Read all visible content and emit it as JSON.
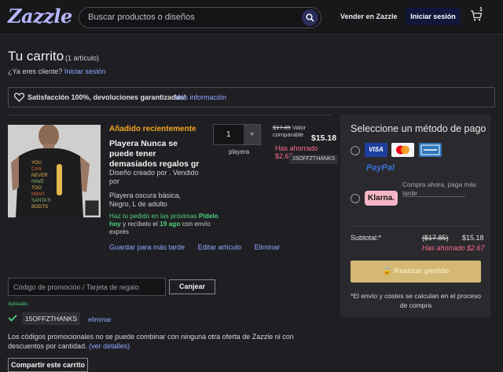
{
  "header": {
    "logo": "Zazzle",
    "search_placeholder": "Buscar productos o diseños",
    "sell_label": "Vender en Zazzle",
    "login_label": "Iniciar sesión",
    "cart_count": "1"
  },
  "page": {
    "title": "Tu carrito",
    "item_count": "(1 artículo)",
    "client_question": "¿Ya eres cliente?",
    "client_login": "Iniciar sesión"
  },
  "banner": {
    "text": "Satisfacción 100%, devoluciones garantizadas!",
    "link": "Más información"
  },
  "item": {
    "recent_label": "Añadido recientemente",
    "name": "Playera Nunca se puede tener demasiados regalos gr",
    "designed_by": "Diseño creado por . Vendido por",
    "variant": "Playera oscura básica, Negro, L de adulto",
    "delivery_prefix": "Haz tu pedido en las próximas",
    "delivery_cta": "Pídelo hoy",
    "delivery_mid": "y recíbelo el",
    "delivery_date": "19 ago",
    "delivery_suffix": "con envío exprés",
    "action_save": "Guardar para más tarde",
    "action_edit": "Editar artículo",
    "action_remove": "Eliminar",
    "quantity": "1",
    "quantity_label": "playera",
    "old_price": "$17.85",
    "old_price_label": "Valor comparable",
    "price": "$15.18",
    "saved": "Has ahorrado $2.67",
    "code": "15OFFZTHANKS",
    "shirt_words": [
      "YOU",
      "CAN",
      "NEVER",
      "HAVE",
      "TOO",
      "MANY",
      "SANTA'S",
      "BOOTS"
    ]
  },
  "promo": {
    "placeholder": "Código de promoción / Tarjeta de regalo",
    "apply_label": "Canjear",
    "applied_label": "Aplicado",
    "code": "15OFFZTHANKS",
    "remove_label": "eliminar",
    "note": "Los códigos promocionales no se puede combinar con ninguna otra oferta de Zazzle ni con descuentos por cantidad.",
    "note_link": "(ver detalles)",
    "share_label": "Compartir este carrito"
  },
  "payment": {
    "title": "Seleccione un método de pago",
    "cards": [
      "VISA",
      "Mastercard",
      "American Express"
    ],
    "paypal": "PayPal",
    "klarna": "Klarna.",
    "klarna_text": "Compra ahora, paga más tarde",
    "subtotal_label": "Subtotal:*",
    "subtotal_old": "($17.85)",
    "subtotal_new": "$15.18",
    "subtotal_saved": "Has ahorrado $2.67",
    "checkout_label": "Realizar pedido",
    "shipping_note": "*El envío y costes se calculan en el proceso de compra"
  },
  "colors": {
    "accent_link": "#8fa8ff",
    "saved_pink": "#ff6b8a",
    "green": "#4fd17a",
    "recent_orange": "#f5a623",
    "checkout_gold": "#d4b873"
  }
}
